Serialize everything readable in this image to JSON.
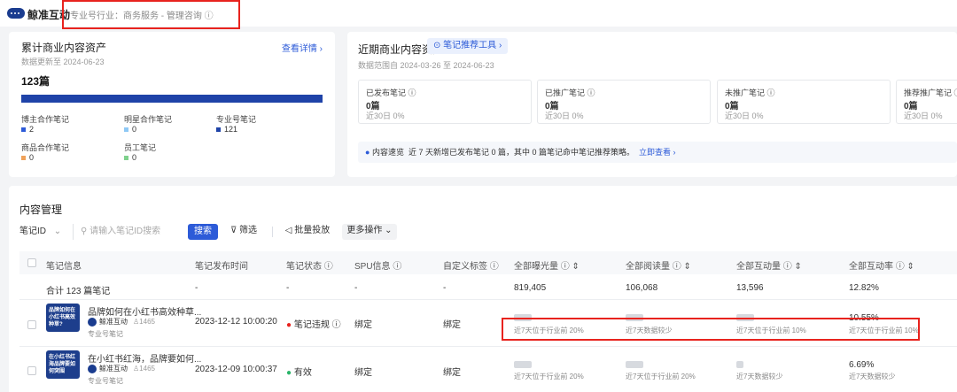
{
  "header": {
    "brand": "鲸准互动",
    "industry": "专业号行业：商务服务 - 管理咨询 ⓘ"
  },
  "left_card": {
    "title": "累计商业内容资产",
    "link": "查看详情 ›",
    "updated": "数据更新至 2024-06-23",
    "total": "123篇",
    "cats": [
      {
        "label": "博主合作笔记",
        "value": "2",
        "color": "#2d5bd8"
      },
      {
        "label": "明星合作笔记",
        "value": "0",
        "color": "#8fc9f5"
      },
      {
        "label": "专业号笔记",
        "value": "121",
        "color": "#1f43a8"
      },
      {
        "label": "商品合作笔记",
        "value": "0",
        "color": "#f0a25a"
      },
      {
        "label": "员工笔记",
        "value": "0",
        "color": "#7fd18d"
      }
    ]
  },
  "right_card": {
    "title": "近期商业内容资产",
    "tool": "笔记推荐工具 ›",
    "range": "数据范围自 2024-03-26 至 2024-06-23",
    "stats": [
      {
        "label": "已发布笔记 ⓘ",
        "value": "0篇",
        "sub": "近30日 0%"
      },
      {
        "label": "已推广笔记 ⓘ",
        "value": "0篇",
        "sub": "近30日 0%"
      },
      {
        "label": "未推广笔记 ⓘ",
        "value": "0篇",
        "sub": "近30日 0%"
      },
      {
        "label": "推荐推广笔记 ⓘ",
        "value": "0篇",
        "sub": "近30日 0%"
      }
    ],
    "tip_label": "内容速览",
    "tip_text": "近 7 天新增已发布笔记 0 篇，其中 0 篇笔记命中笔记推荐策略。",
    "tip_link": "立即查看 ›"
  },
  "content": {
    "title": "内容管理",
    "select": "笔记ID",
    "search_placeholder": "请输入笔记ID搜索",
    "search_btn": "搜索",
    "filter_btn": "筛选",
    "batch_btn": "批量投放",
    "more_btn": "更多操作 ⌄",
    "columns": [
      "笔记信息",
      "笔记发布时间",
      "笔记状态 ⓘ",
      "SPU信息 ⓘ",
      "自定义标签 ⓘ",
      "全部曝光量 ⓘ ⇕",
      "全部阅读量 ⓘ ⇕",
      "全部互动量 ⓘ ⇕",
      "全部互动率 ⓘ ⇕"
    ],
    "total_row": [
      "合计 123 篇笔记",
      "-",
      "-",
      "-",
      "-",
      "819,405",
      "106,068",
      "13,596",
      "12.82%"
    ],
    "rows": [
      {
        "title": "品牌如何在小红书高效种草...",
        "thumb": "品牌如何在小红书高效种草?",
        "account": "鲸准互动",
        "fans": "1465",
        "type": "专业号笔记",
        "time": "2023-12-12 10:00:20",
        "status": "笔记违规 ⓘ",
        "status_color": "#e8231e",
        "spu": "绑定",
        "tag": "绑定",
        "m1": "近7天位于行业前 20%",
        "m2": "近7天数据较少",
        "m3": "近7天位于行业前 10%",
        "rate": "10.55%",
        "m4": "近7天位于行业前 10%"
      },
      {
        "title": "在小红书红海，品牌要如何...",
        "thumb": "在小红书红海品牌要如何突围",
        "account": "鲸准互动",
        "fans": "1465",
        "type": "专业号笔记",
        "time": "2023-12-09 10:00:37",
        "status": "有效",
        "status_color": "#2bb56a",
        "spu": "绑定",
        "tag": "绑定",
        "m1": "近7天位于行业前 20%",
        "m2": "近7天位于行业前 20%",
        "m3": "近7天数据较少",
        "rate": "6.69%",
        "m4": "近7天数据较少"
      }
    ]
  }
}
